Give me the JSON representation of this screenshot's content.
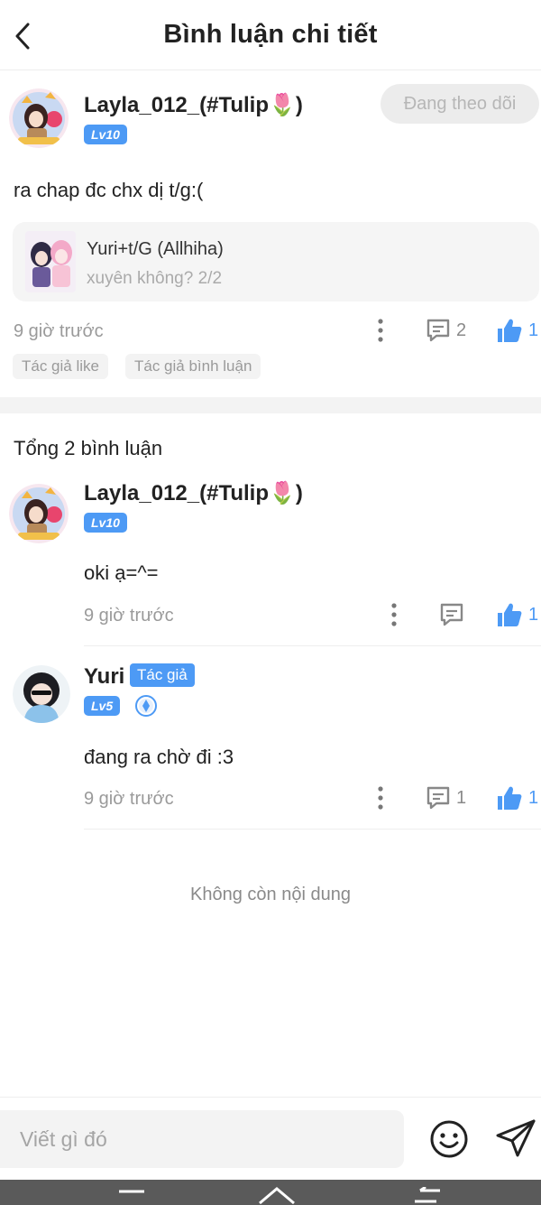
{
  "header": {
    "title": "Bình luận chi tiết"
  },
  "main_comment": {
    "username": "Layla_012_(#Tulip🌷)",
    "level": "Lv10",
    "follow_label": "Đang theo dõi",
    "text": "ra chap đc chx dị t/g:(",
    "quote": {
      "title": "Yuri+t/G (Allhiha)",
      "subtitle": "xuyên không? 2/2"
    },
    "time": "9 giờ trước",
    "reply_count": "2",
    "like_count": "1",
    "tags": [
      "Tác giả like",
      "Tác giả bình luận"
    ]
  },
  "total_label": "Tổng 2 bình luận",
  "replies": [
    {
      "username": "Layla_012_(#Tulip🌷)",
      "level": "Lv10",
      "text": "oki ạ=^=",
      "time": "9 giờ trước",
      "reply_count": "",
      "like_count": "1"
    },
    {
      "username": "Yuri",
      "author_tag": "Tác giả",
      "level": "Lv5",
      "text": "đang ra chờ đi :3",
      "time": "9 giờ trước",
      "reply_count": "1",
      "like_count": "1"
    }
  ],
  "no_more": "Không còn nội dung",
  "input": {
    "placeholder": "Viết gì đó"
  },
  "colors": {
    "accent": "#4d9af5",
    "muted": "#9a9a9a"
  }
}
